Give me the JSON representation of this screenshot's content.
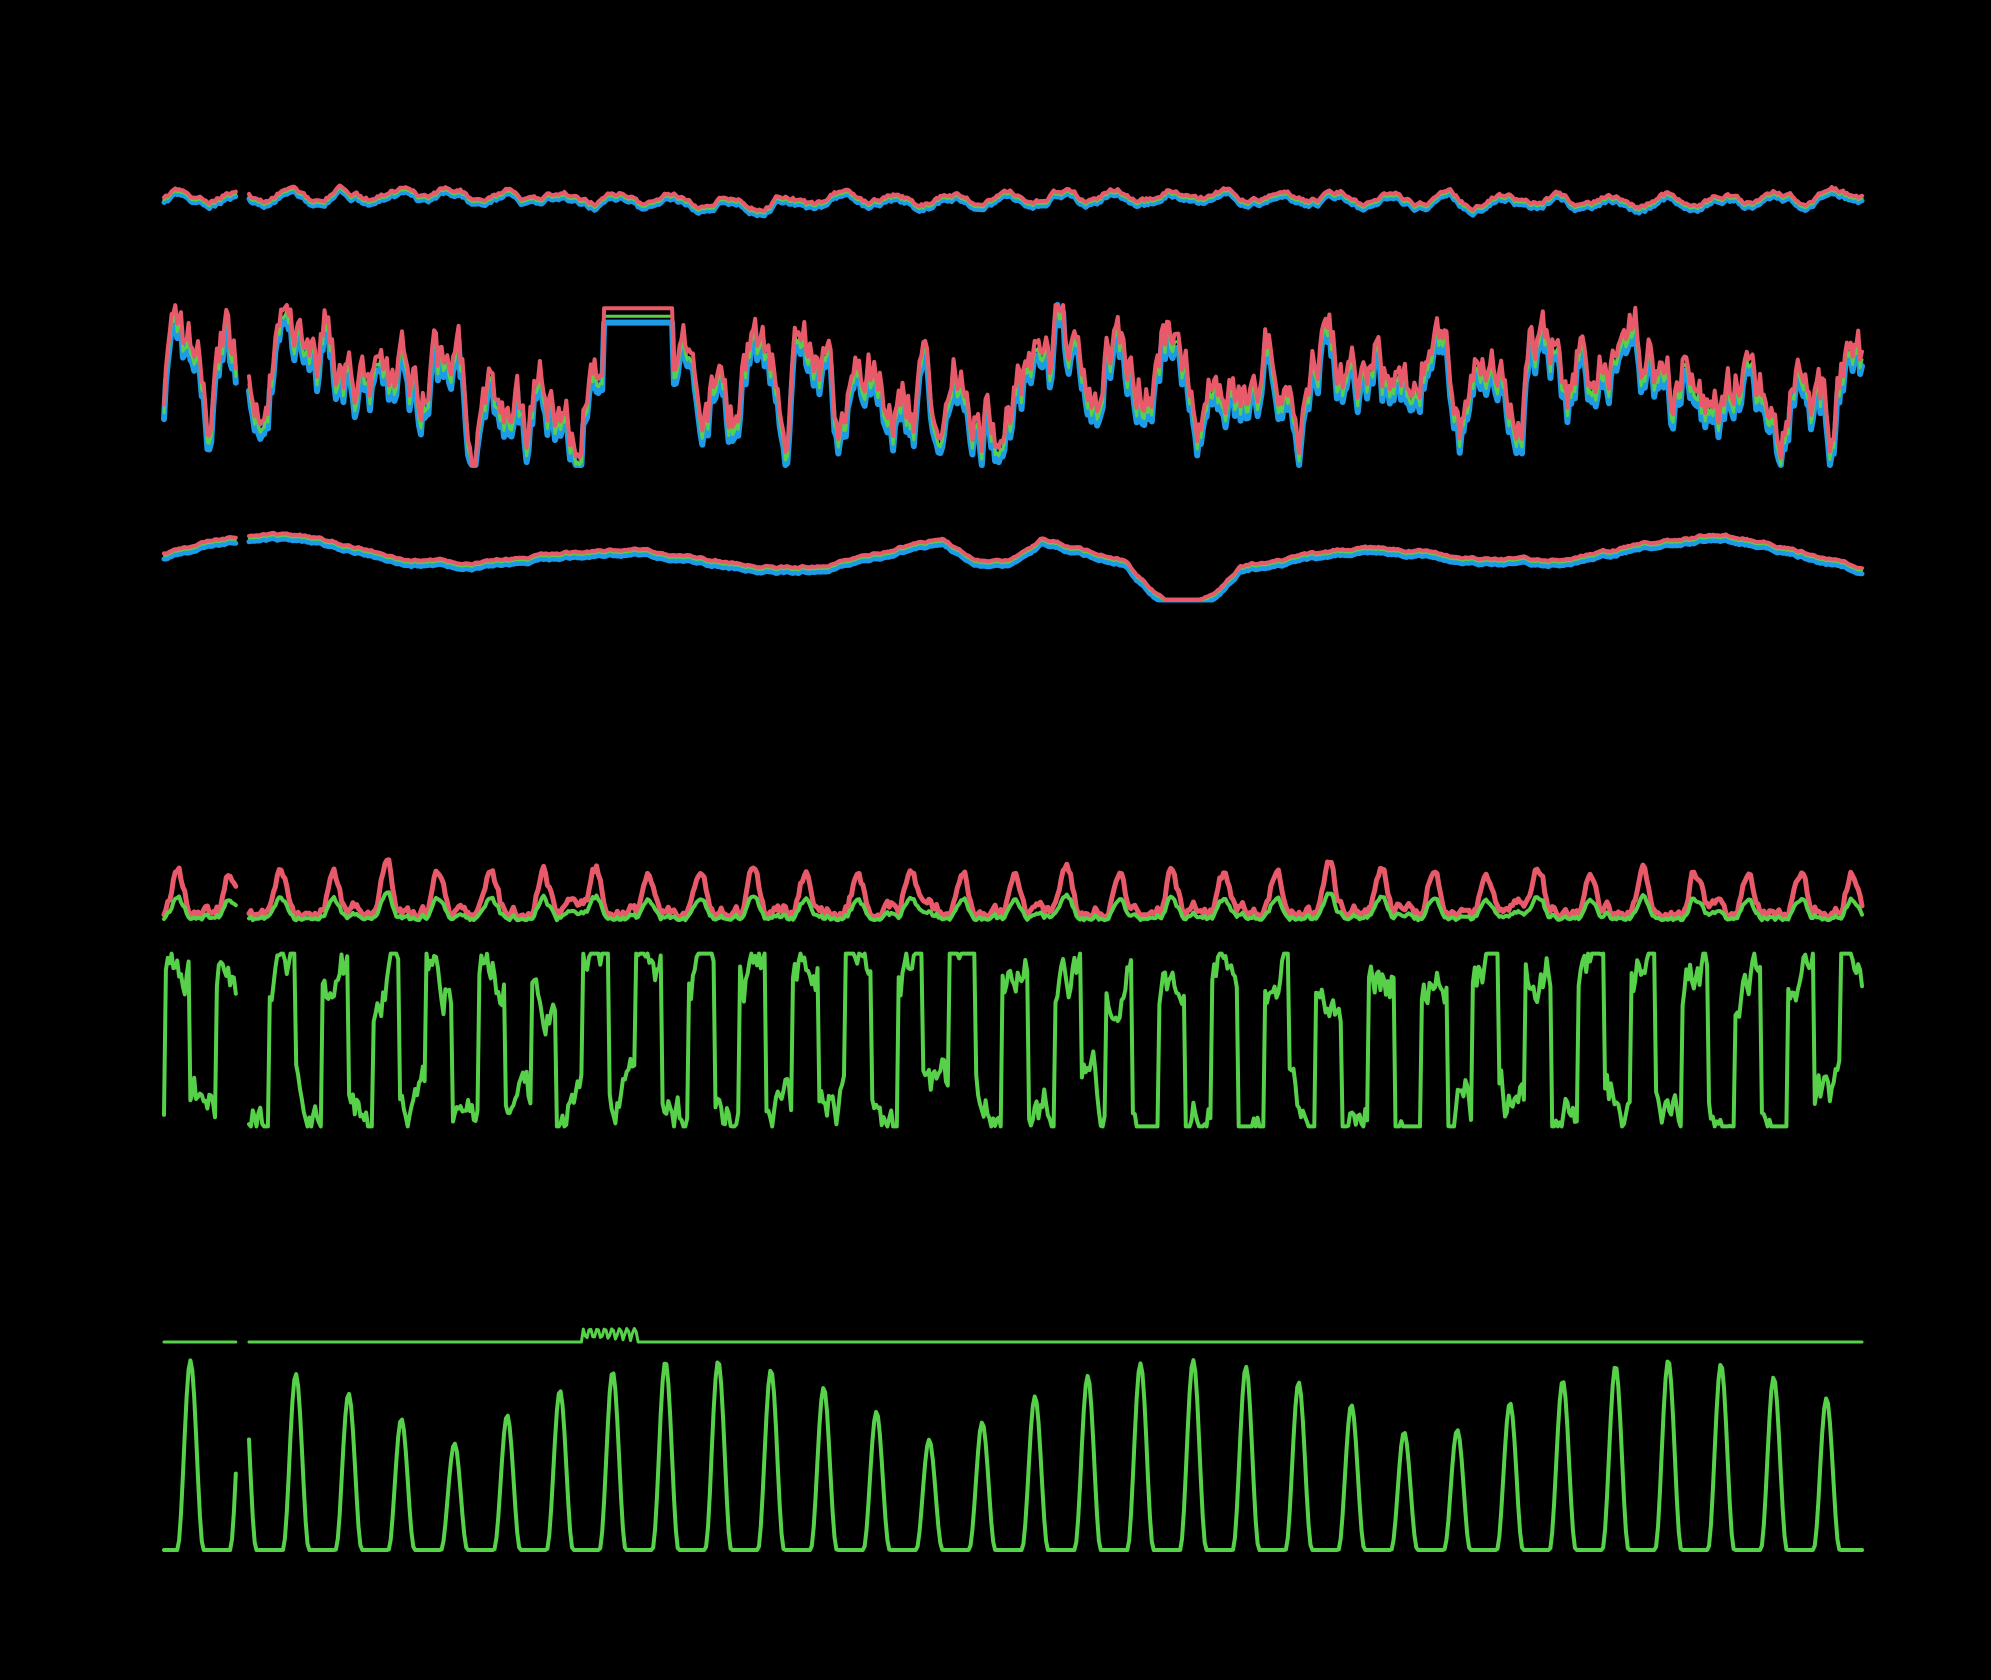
{
  "chart_data": {
    "type": "line",
    "background": "#000000",
    "grid": false,
    "legend": "none",
    "colors": {
      "red": "#e85a6a",
      "green": "#57d149",
      "blue": "#1e9be6"
    },
    "gap": [
      5.2,
      6.0
    ],
    "xlim": [
      0,
      120
    ],
    "panels": [
      {
        "id": "temperature-like",
        "ylim": [
          0,
          1
        ],
        "series": [
          {
            "color": "blue",
            "stroke": 5,
            "gen": {
              "kind": "smooth",
              "base": 0.58,
              "amp": 0.16,
              "period": 3.9,
              "seed": 3,
              "noise": 0.06,
              "offset": -0.04
            }
          },
          {
            "color": "green",
            "stroke": 3,
            "gen": {
              "kind": "smooth",
              "base": 0.58,
              "amp": 0.16,
              "period": 3.9,
              "seed": 3,
              "noise": 0.06,
              "offset": 0.0
            }
          },
          {
            "color": "red",
            "stroke": 4,
            "gen": {
              "kind": "smooth",
              "base": 0.58,
              "amp": 0.16,
              "period": 3.9,
              "seed": 3,
              "noise": 0.06,
              "offset": 0.03
            }
          }
        ]
      },
      {
        "id": "humidity-like",
        "ylim": [
          0,
          1
        ],
        "series": [
          {
            "color": "blue",
            "stroke": 6,
            "gen": {
              "kind": "jagged",
              "base": 0.5,
              "amp": 0.32,
              "period": 3.7,
              "seed": 11,
              "noise": 0.22,
              "offset": -0.06
            }
          },
          {
            "color": "green",
            "stroke": 3,
            "gen": {
              "kind": "jagged",
              "base": 0.5,
              "amp": 0.32,
              "period": 3.7,
              "seed": 11,
              "noise": 0.22,
              "offset": -0.02
            }
          },
          {
            "color": "red",
            "stroke": 4,
            "gen": {
              "kind": "jagged",
              "base": 0.5,
              "amp": 0.32,
              "period": 3.7,
              "seed": 11,
              "noise": 0.22,
              "offset": 0.03
            }
          }
        ]
      },
      {
        "id": "pressure-like",
        "ylim": [
          0,
          1
        ],
        "series": [
          {
            "color": "blue",
            "stroke": 5,
            "gen": {
              "kind": "slow",
              "base": 0.55,
              "amp": 0.3,
              "period": 26,
              "seed": 5,
              "noise": 0.04,
              "offset": -0.04
            }
          },
          {
            "color": "green",
            "stroke": 2,
            "gen": {
              "kind": "slow",
              "base": 0.55,
              "amp": 0.3,
              "period": 26,
              "seed": 5,
              "noise": 0.04,
              "offset": 0.0
            }
          },
          {
            "color": "red",
            "stroke": 4,
            "gen": {
              "kind": "slow",
              "base": 0.55,
              "amp": 0.3,
              "period": 26,
              "seed": 5,
              "noise": 0.04,
              "offset": 0.03
            }
          }
        ]
      },
      {
        "id": "wind-like",
        "ylim": [
          0,
          1
        ],
        "series": [
          {
            "color": "red",
            "stroke": 5,
            "gen": {
              "kind": "bumps",
              "base": 0.08,
              "amp": 0.42,
              "period": 3.7,
              "seed": 21,
              "noise": 0.14,
              "offset": 0.0
            }
          },
          {
            "color": "green",
            "stroke": 4,
            "gen": {
              "kind": "bumps",
              "base": 0.05,
              "amp": 0.2,
              "period": 3.7,
              "seed": 21,
              "noise": 0.07,
              "offset": 0.0
            }
          }
        ]
      },
      {
        "id": "direction-like",
        "ylim": [
          0,
          1
        ],
        "series": [
          {
            "color": "green",
            "stroke": 4,
            "gen": {
              "kind": "square",
              "base": 0.5,
              "amp": 0.78,
              "period": 3.7,
              "seed": 31,
              "noise": 0.18,
              "offset": 0.0
            }
          }
        ]
      },
      {
        "id": "precip-like",
        "ylim": [
          0,
          1
        ],
        "series": [
          {
            "color": "green",
            "stroke": 3,
            "gen": {
              "kind": "flat",
              "base": 0.2,
              "amp": 0.0,
              "period": 1,
              "seed": 41,
              "noise": 0.0,
              "offset": 0.0
            }
          }
        ]
      },
      {
        "id": "radiation-like",
        "ylim": [
          0,
          1
        ],
        "series": [
          {
            "color": "green",
            "stroke": 4,
            "gen": {
              "kind": "peaks",
              "base": 0.0,
              "amp": 1.0,
              "period": 3.73,
              "seed": 51,
              "noise": 0.0,
              "offset": 0.0
            }
          }
        ]
      }
    ]
  }
}
